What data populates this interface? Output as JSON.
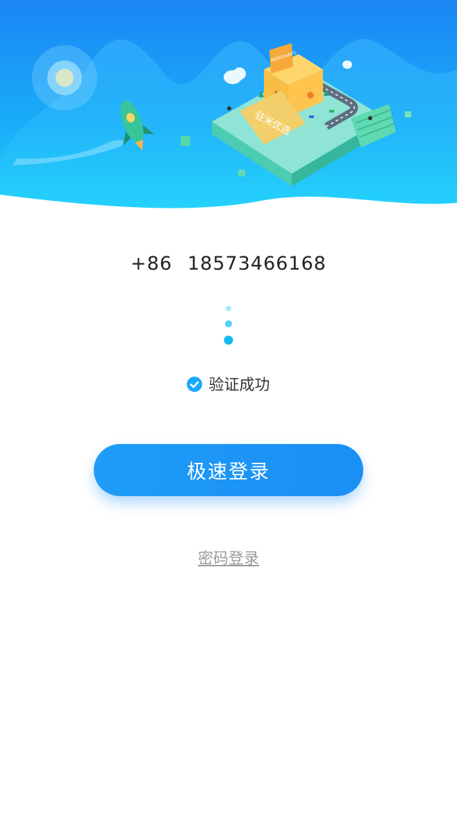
{
  "hero": {
    "sign_text": "驻米优选",
    "roof_text": "MERCHANTS",
    "colors": {
      "sky_top": "#1e8df6",
      "sky_bottom": "#1ec9f9"
    }
  },
  "phone": {
    "country_code": "+86",
    "number": "18573466168"
  },
  "verify": {
    "label": "验证成功",
    "icon": "check-circle-icon",
    "color": "#1aa7ff"
  },
  "login_button": {
    "label": "极速登录",
    "color": "#1f9cf7"
  },
  "password_login": {
    "label": "密码登录"
  }
}
